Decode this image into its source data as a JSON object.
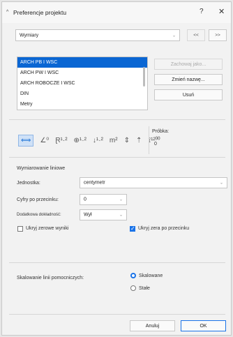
{
  "title": "Preferencje projektu",
  "title_icon": "^",
  "help_glyph": "?",
  "close_glyph": "✕",
  "page_combo": {
    "value": "Wymiary",
    "arrow": "⌄"
  },
  "nav": {
    "prev": "<<",
    "next": ">>"
  },
  "standards": {
    "items": [
      "ARCH PB I WSC",
      "ARCH PW I WSC",
      "ARCH ROBOCZE I WSC",
      "DIN",
      "Metry"
    ],
    "selected_index": 0
  },
  "actions": {
    "save_as": "Zachowaj jako...",
    "rename": "Zmień nazwę...",
    "delete": "Usuń"
  },
  "dimension_types": [
    {
      "icon": "linear-dimension-icon",
      "glyph": "⟺"
    },
    {
      "icon": "angle-dimension-icon",
      "glyph": "∠⁰"
    },
    {
      "icon": "radius-dimension-icon",
      "glyph": "Ɽ¹·²"
    },
    {
      "icon": "level-dimension-icon",
      "glyph": "⊕¹·²"
    },
    {
      "icon": "elevation-dimension-icon",
      "glyph": "↓¹·²"
    },
    {
      "icon": "area-dimension-icon",
      "glyph": "m²"
    },
    {
      "icon": "window-door-dimension-icon",
      "glyph": "⇕"
    },
    {
      "icon": "sill-height-icon",
      "glyph": "⇡"
    },
    {
      "icon": "detail-dimension-icon",
      "glyph": "⟟¹²⁰⁰"
    }
  ],
  "preview": {
    "label": "Próbka:",
    "value": "0"
  },
  "section_title": "Wymiarowanie liniowe",
  "unit": {
    "label": "Jednostka:",
    "value": "centymetr"
  },
  "decimals": {
    "label": "Cyfry po przecinku:",
    "value": "0"
  },
  "extra_accuracy": {
    "label": "Dodatkowa dokładność:",
    "value": "Wył"
  },
  "hide_zero_results": {
    "label": "Ukryj zerowe wyniki",
    "checked": false
  },
  "hide_zero_decimals": {
    "label": "Ukryj zera po przecinku",
    "checked": true
  },
  "witness_scaling": {
    "label": "Skalowanie linii pomocniczych:",
    "options": [
      "Skalowane",
      "Stałe"
    ],
    "selected": "Skalowane"
  },
  "footer": {
    "cancel": "Anuluj",
    "ok": "OK"
  },
  "colors": {
    "accent": "#0a66d3",
    "checkbox": "#1a73e8"
  }
}
